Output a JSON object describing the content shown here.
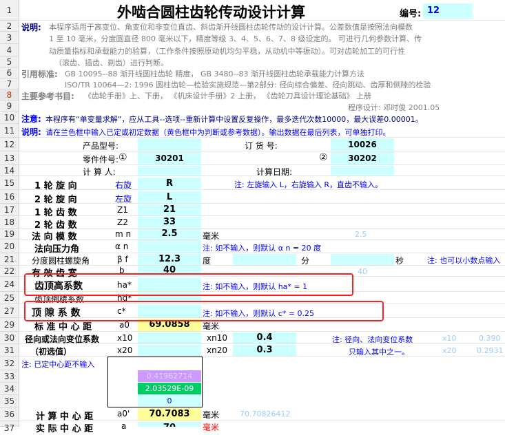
{
  "rows": {
    "r1": "1",
    "r2": "2",
    "r3": "3",
    "r4": "4",
    "r5": "5",
    "r6": "6",
    "r7": "7",
    "r8": "8",
    "r9": "9",
    "r10": "10",
    "r11": "11",
    "r12": "12",
    "r13": "13",
    "r14": "14",
    "r15": "15",
    "r16": "16",
    "r17": "17",
    "r18": "18",
    "r19": "19",
    "r20": "20",
    "r21": "21",
    "r22": "22",
    "r24": "24",
    "r25": "25",
    "r27": "27",
    "r29": "29",
    "r30": "30",
    "r31": "31",
    "r32": "32",
    "r33": "33",
    "r34": "34",
    "r35": "35",
    "r36": "36",
    "r37": "37"
  },
  "header": {
    "title": "外啮合圆柱齿轮传动设计计算",
    "number_label": "编号:",
    "number_value": "12"
  },
  "desc": {
    "label": "说明:",
    "line1": "本程序适用于高变位、角变位和非变位直齿、斜齿渐开线圆柱齿轮传动的设计计算。公差数值是按照法向模数",
    "line2": "1 至 10 毫米，分度圆直径 800 毫米以下，精度等级 3、4、5、6、7、8 级设定的。 可进行几何参数计算、传",
    "line3": "动质量指标和承载能力的验算，（工作条件按照原动机均匀平稳，从动机中等振动）。可对齿轮加工的可行性",
    "line4": "（滚齿、插齿、剃齿）进行判断。"
  },
  "standards": {
    "label": "引用标准:",
    "line1": "GB 10095--88  渐开线圆柱齿轮  精度，     GB 3480--83  渐开线圆柱齿轮承载能力计算方法",
    "line2": "ISO/TR 10064—2: 1996  圆柱齿轮—检验实施规范—第2部分: 径向综合偏差、径向跳动、齿厚和侧隙的检验"
  },
  "refs": {
    "label": "主要参考书目:",
    "text": "《齿轮手册》上、下册，   《机床设计手册》2 上册，   《齿轮刀具设计理论基础》     上册"
  },
  "designer": "程序设计: 邓时俊     2001.05",
  "notice": {
    "label": "注意:",
    "text": "本程序有“单变量求解”，应从工具--选项--重新计算中设置反复操作，最多迭代次数10000，最大误差0.00001。"
  },
  "note2": {
    "label": "说明:",
    "text": "请在兰色框中输入已定或初定数据（黄色框中为判断或参考数据）。输出数据在最后列表，可单独打印。"
  },
  "form": {
    "product_label": "产品型号:",
    "order_label": "订  货  号:",
    "order_value": "10026",
    "part_label": "零件件号:",
    "circle1": "①",
    "part1": "30201",
    "circle2": "②",
    "part2": "30202",
    "calc_label": "计  算  人:",
    "date_label": "计算日期:"
  },
  "params": {
    "g1_dir_label": "1  轮  旋  向",
    "g1_dir_sym": "右旋",
    "g1_dir_val": "R",
    "dir_note": "注: 左旋输入 L，右旋输入 R，直齿不输入。",
    "g2_dir_label": "2  轮  旋  向",
    "g2_dir_sym": "左旋",
    "g2_dir_val": "L",
    "z1_label": "1  轮  齿  数",
    "z1_sym": "Z1",
    "z1_val": "21",
    "z2_label": "2  轮  齿  数",
    "z2_sym": "Z2",
    "z2_val": "33",
    "mn_label": "法  向  模  数",
    "mn_sym": "m n",
    "mn_val": "2.5",
    "mn_unit": "毫米",
    "mn_ref": "2.5",
    "an_label": "法向压力角",
    "an_sym": "α n",
    "an_note": "注: 如不输入，则默认 α n = 20 度",
    "beta_label": "分度圆柱螺旋角",
    "beta_sym": "β f",
    "beta_val": "12.3",
    "beta_deg": "度",
    "beta_min": "分",
    "beta_sec": "秒",
    "beta_note": "注: 也可以小数点输入",
    "b_label": "有  效  齿  宽",
    "b_sym": "b",
    "b_val": "40",
    "b_ref": "40",
    "ha_label": "齿顶高系数",
    "ha_sym": "ha*",
    "ha_note": "注: 如不输入，则默认 ha* = 1",
    "hd_label": "齿顶倒棱系数",
    "hd_sym": "hd*",
    "c_label": "顶  隙  系  数",
    "c_sym": "c*",
    "c_note": "注: 如不输入，则默认 c* = 0.25",
    "a0_label": "标  准  中  心  距",
    "a0_sym": "a0",
    "a0_val": "69.0858",
    "a0_unit": "毫米",
    "x10_label": "径向或法向变位系数",
    "x10_sym": "x10",
    "xn10_sym": "xn10",
    "xn10_val": "0.4",
    "x_note1": "注: 径向、法向变位系数",
    "x10_ref_sym": "x10",
    "x10_ref_val": "0.390",
    "x20_label": "（初选值）",
    "x20_sym": "x20",
    "xn20_sym": "xn20",
    "xn20_val": "0.3",
    "x_note2": "只输入其中之一。",
    "x20_ref_sym": "x20",
    "x20_ref_val": "0.2931",
    "center_note": "注: 已定中心距不输入",
    "purple_val": "0.41962714",
    "green_val": "2.03529E-09",
    "zero_val": "0",
    "a0p_label": "计  算  中  心  距",
    "a0p_sym": "a0'",
    "a0p_val": "70.7083",
    "a0p_unit": "毫米",
    "a0p_ref": "70.70826412",
    "a_label": "实  际  中  心  距",
    "a_sym": "a",
    "a_val": "70",
    "a_unit": "毫米"
  },
  "colors": {
    "input": "#ccffff",
    "reference": "#ffff99",
    "highlight_box": "#ff2020"
  }
}
